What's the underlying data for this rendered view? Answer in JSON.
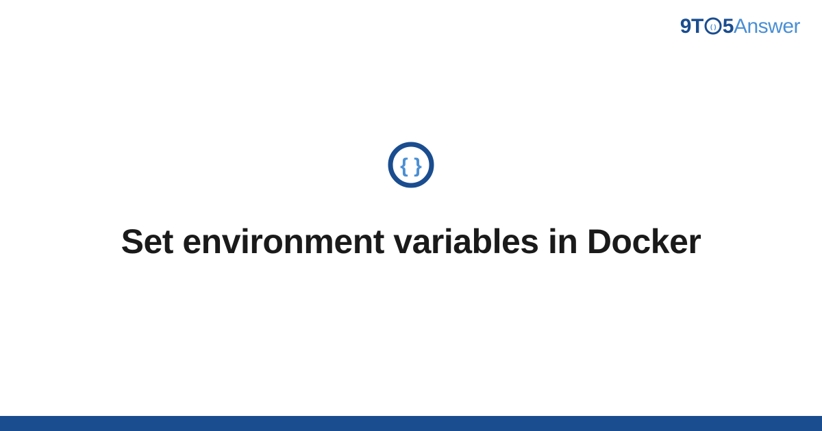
{
  "brand": {
    "part1": "9",
    "part2": "T",
    "part3_inner": "()",
    "part4": "5",
    "part5": "Answer"
  },
  "icon": {
    "name": "braces-circle-icon",
    "glyph": "{ }"
  },
  "title": "Set environment variables in Docker",
  "colors": {
    "primary": "#1a4d8f",
    "accent": "#4a8fd4"
  }
}
